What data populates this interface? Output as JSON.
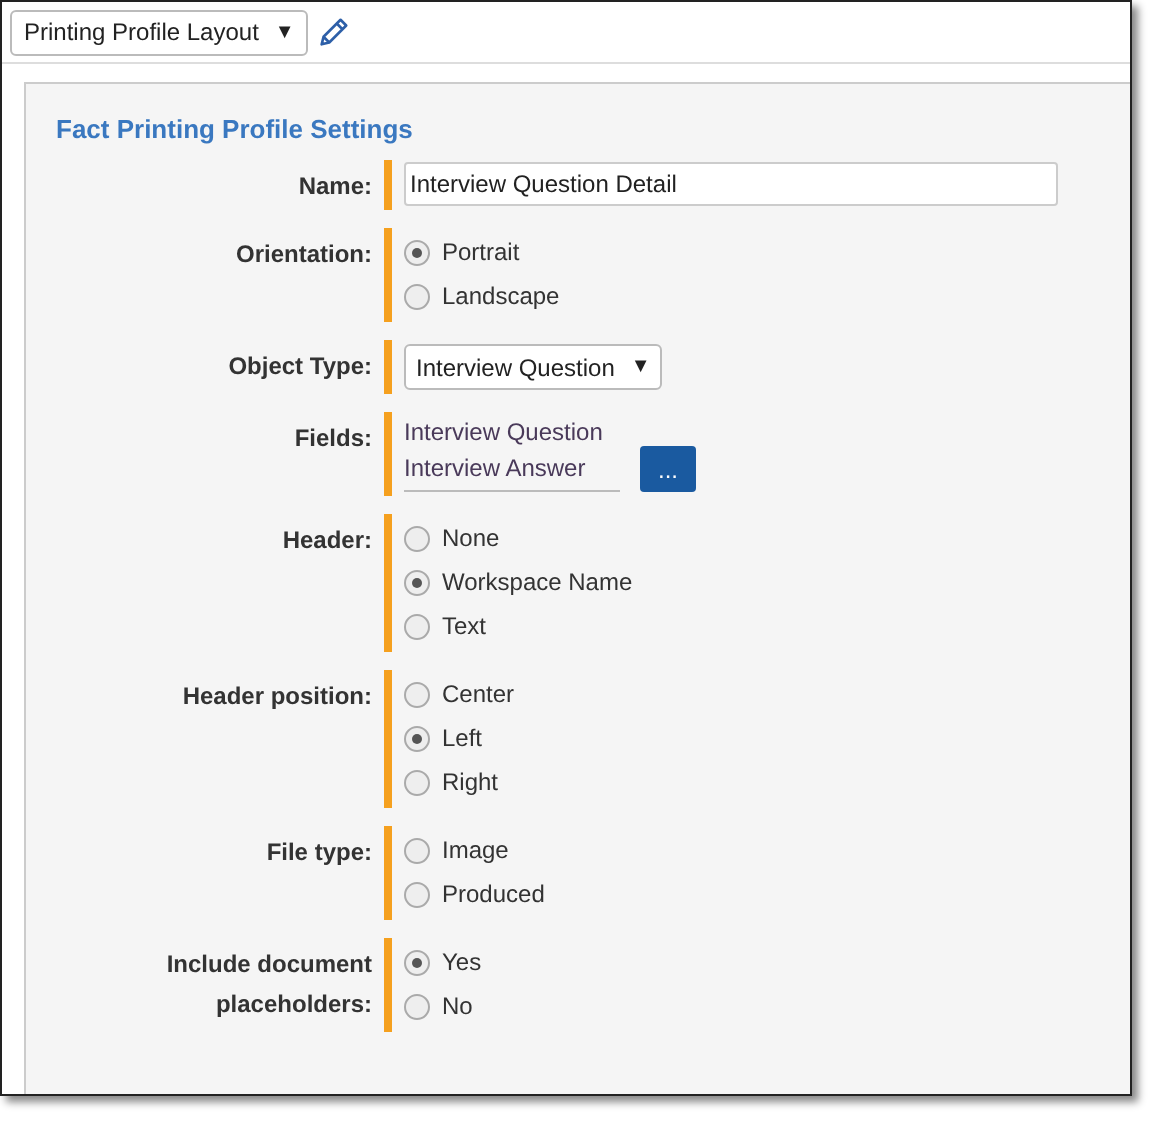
{
  "toolbar": {
    "layout_select": "Printing Profile Layout",
    "caret": "▼"
  },
  "panel": {
    "title": "Fact Printing Profile Settings",
    "rows": [
      {
        "kind": "text",
        "label": "Name:",
        "value": "Interview Question Detail"
      },
      {
        "kind": "radio",
        "label": "Orientation:",
        "options": [
          {
            "label": "Portrait",
            "selected": true
          },
          {
            "label": "Landscape",
            "selected": false
          }
        ]
      },
      {
        "kind": "select",
        "label": "Object Type:",
        "value": "Interview Question",
        "caret": "▼"
      },
      {
        "kind": "fields",
        "label": "Fields:",
        "values": [
          "Interview Question",
          "Interview Answer"
        ],
        "button": "..."
      },
      {
        "kind": "radio",
        "label": "Header:",
        "options": [
          {
            "label": "None",
            "selected": false
          },
          {
            "label": "Workspace Name",
            "selected": true
          },
          {
            "label": "Text",
            "selected": false
          }
        ]
      },
      {
        "kind": "radio",
        "label": "Header position:",
        "options": [
          {
            "label": "Center",
            "selected": false
          },
          {
            "label": "Left",
            "selected": true
          },
          {
            "label": "Right",
            "selected": false
          }
        ]
      },
      {
        "kind": "radio",
        "label": "File type:",
        "options": [
          {
            "label": "Image",
            "selected": false
          },
          {
            "label": "Produced",
            "selected": false
          }
        ]
      },
      {
        "kind": "radio",
        "label": "Include document placeholders:",
        "options": [
          {
            "label": "Yes",
            "selected": true
          },
          {
            "label": "No",
            "selected": false
          }
        ]
      }
    ]
  }
}
